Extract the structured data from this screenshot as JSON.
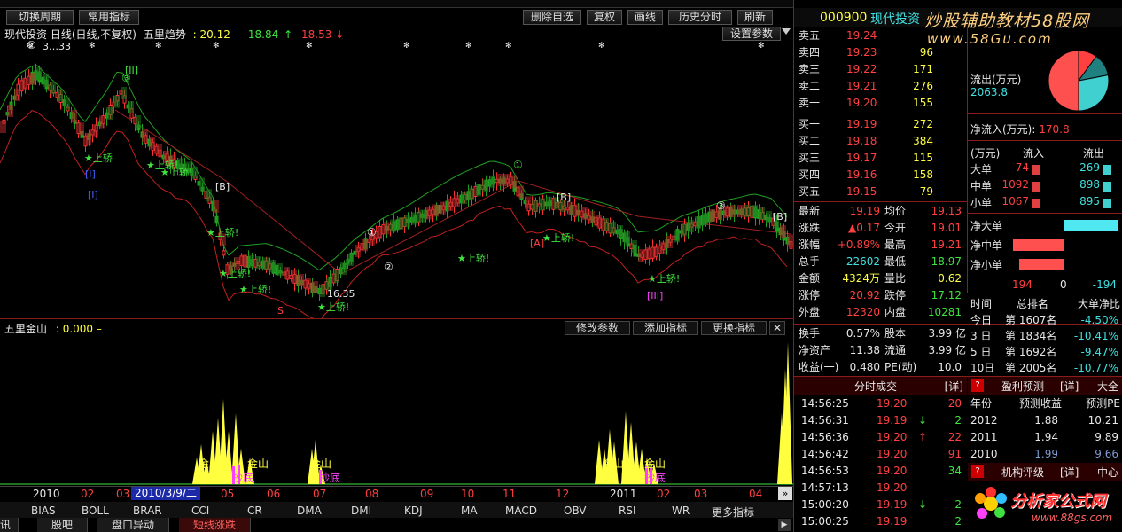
{
  "toolbar": {
    "cycle": "切换周期",
    "common": "常用指标",
    "delete_fav": "删除自选",
    "restore": "复权",
    "draw": "画线",
    "history": "历史分时",
    "refresh": "刷新"
  },
  "chart": {
    "title": "现代投资 日线(日线,不复权)",
    "ind_name": "五里趋势",
    "v1": "20.12",
    "sep": "-",
    "v2": "18.84",
    "arrow_up": "↑",
    "v3": "18.53",
    "arrow_down": "↓",
    "settings": "设置参数",
    "high_label": "3…33",
    "low_label": "16.35",
    "sell_labels": [
      "上轿",
      "上轿!",
      "上轿!",
      "上轿!",
      "上轿!",
      "上轿!",
      "上轿!",
      "上轿!",
      "上轿!",
      "上轿!"
    ],
    "wave_labels": [
      "[II]",
      "[I]",
      "[I]",
      "[B]",
      "[B]",
      "[B]",
      "[A]",
      "[III]",
      "[III]"
    ],
    "circle_labels": [
      "②",
      "③",
      "①",
      "②",
      "③",
      "①"
    ],
    "letter_s": "S"
  },
  "sub": {
    "title": "五里金山",
    "value": ": 0.000 –",
    "modify": "修改参数",
    "add": "添加指标",
    "replace": "更换指标",
    "close": "✕",
    "labels": [
      "金山",
      "金山",
      "金山",
      "金山",
      "金山",
      "金山",
      "抄底",
      "抄底",
      "抄底"
    ]
  },
  "timeline": {
    "year1": "2010",
    "m02": "02",
    "m03": "03",
    "date": "2010/3/9/二",
    "m05": "05",
    "m06": "06",
    "m07": "07",
    "m08": "08",
    "m09": "09",
    "m10": "10",
    "m11": "11",
    "m12": "12",
    "year2": "2011",
    "m02b": "02",
    "m03b": "03",
    "m04": "04"
  },
  "indicators": [
    "BIAS",
    "BOLL",
    "BRAR",
    "CCI",
    "CR",
    "DMA",
    "DMI",
    "KDJ",
    "MA",
    "MACD",
    "OBV",
    "RSI",
    "WR",
    "更多指标"
  ],
  "bottom_tabs": [
    "讯",
    "股吧",
    "盘口异动",
    "短线涨跌"
  ],
  "stock": {
    "code": "000900",
    "name": "现代投资"
  },
  "watermark": {
    "line1": "炒股辅助教材58股网",
    "line2": "www.58Gu.com"
  },
  "order_book": {
    "sells": [
      {
        "label": "卖五",
        "price": "19.24",
        "vol": ""
      },
      {
        "label": "卖四",
        "price": "19.23",
        "vol": "96"
      },
      {
        "label": "卖三",
        "price": "19.22",
        "vol": "171"
      },
      {
        "label": "卖二",
        "price": "19.21",
        "vol": "276"
      },
      {
        "label": "卖一",
        "price": "19.20",
        "vol": "155"
      }
    ],
    "buys": [
      {
        "label": "买一",
        "price": "19.19",
        "vol": "272"
      },
      {
        "label": "买二",
        "price": "19.18",
        "vol": "384"
      },
      {
        "label": "买三",
        "price": "19.17",
        "vol": "115"
      },
      {
        "label": "买四",
        "price": "19.16",
        "vol": "158"
      },
      {
        "label": "买五",
        "price": "19.15",
        "vol": "79"
      }
    ]
  },
  "flows": {
    "out_label": "流出(万元)",
    "out_value": "2063.8",
    "net_label": "净流入(万元):",
    "net_value": "170.8",
    "header": [
      "(万元)",
      "流入",
      "流出"
    ],
    "rows": [
      {
        "name": "大单",
        "in": "74",
        "out": "269"
      },
      {
        "name": "中单",
        "in": "1092",
        "out": "898"
      },
      {
        "name": "小单",
        "in": "1067",
        "out": "895"
      }
    ],
    "net_large": "净大单",
    "net_mid": "净中单",
    "net_small": "净小单",
    "totals": [
      "194",
      "0",
      "-194"
    ]
  },
  "quote": [
    {
      "l1": "最新",
      "v1": "19.19",
      "l2": "均价",
      "v2": "19.13"
    },
    {
      "l1": "涨跌",
      "v1": "▲0.17",
      "l2": "今开",
      "v2": "19.01"
    },
    {
      "l1": "涨幅",
      "v1": "+0.89%",
      "l2": "最高",
      "v2": "19.21"
    },
    {
      "l1": "总手",
      "v1": "22602",
      "l2": "最低",
      "v2": "18.97"
    },
    {
      "l1": "金额",
      "v1": "4324万",
      "l2": "量比",
      "v2": "0.62"
    },
    {
      "l1": "涨停",
      "v1": "20.92",
      "l2": "跌停",
      "v2": "17.12"
    },
    {
      "l1": "外盘",
      "v1": "12320",
      "l2": "内盘",
      "v2": "10281"
    }
  ],
  "fundamentals": [
    {
      "l1": "换手",
      "v1": "0.57%",
      "l2": "股本",
      "v2": "3.99 亿"
    },
    {
      "l1": "净资产",
      "v1": "11.38",
      "l2": "流通",
      "v2": "3.99 亿"
    },
    {
      "l1": "收益(一)",
      "v1": "0.480",
      "l2": "PE(动)",
      "v2": "10.0"
    }
  ],
  "ranking": {
    "header": [
      "时间",
      "总排名",
      "大单净比"
    ],
    "rows": [
      {
        "t": "今日",
        "r": "第 1607名",
        "p": "-4.50%"
      },
      {
        "t": "3 日",
        "r": "第 1834名",
        "p": "-10.41%"
      },
      {
        "t": "5 日",
        "r": "第 1692名",
        "p": "-9.47%"
      },
      {
        "t": "10日",
        "r": "第 2005名",
        "p": "-10.77%"
      }
    ]
  },
  "ticks": {
    "title": "分时成交",
    "detail": "[详]",
    "rows": [
      {
        "t": "14:56:25",
        "p": "19.20",
        "v": "20",
        "dir": ""
      },
      {
        "t": "14:56:31",
        "p": "19.19",
        "v": "2",
        "dir": "↓"
      },
      {
        "t": "14:56:36",
        "p": "19.20",
        "v": "22",
        "dir": "↑"
      },
      {
        "t": "14:56:42",
        "p": "19.20",
        "v": "91",
        "dir": ""
      },
      {
        "t": "14:56:53",
        "p": "19.20",
        "v": "34",
        "dir": ""
      },
      {
        "t": "14:57:13",
        "p": "19.20",
        "v": "",
        "dir": ""
      },
      {
        "t": "15:00:20",
        "p": "19.19",
        "v": "2",
        "dir": "↓"
      },
      {
        "t": "15:00:25",
        "p": "19.19",
        "v": "2",
        "dir": ""
      }
    ]
  },
  "forecast": {
    "q": "?",
    "title": "盈利预测",
    "detail": "[详]",
    "big": "大全",
    "header": [
      "年份",
      "预测收益",
      "预测PE"
    ],
    "rows": [
      {
        "y": "2012",
        "e": "1.88",
        "pe": "10.21"
      },
      {
        "y": "2011",
        "e": "1.94",
        "pe": "9.89"
      },
      {
        "y": "2010",
        "e": "1.99",
        "pe": "9.66"
      }
    ]
  },
  "org": {
    "q": "?",
    "title": "机构评级",
    "detail": "[详]",
    "center": "中心"
  },
  "logo": {
    "line1": "分析家公式网",
    "line2": "www.88gs.com"
  },
  "colors": {
    "up": "#ff4040",
    "down": "#3fe33f",
    "accent": "#40e0e0",
    "yellow": "#ffff40"
  }
}
